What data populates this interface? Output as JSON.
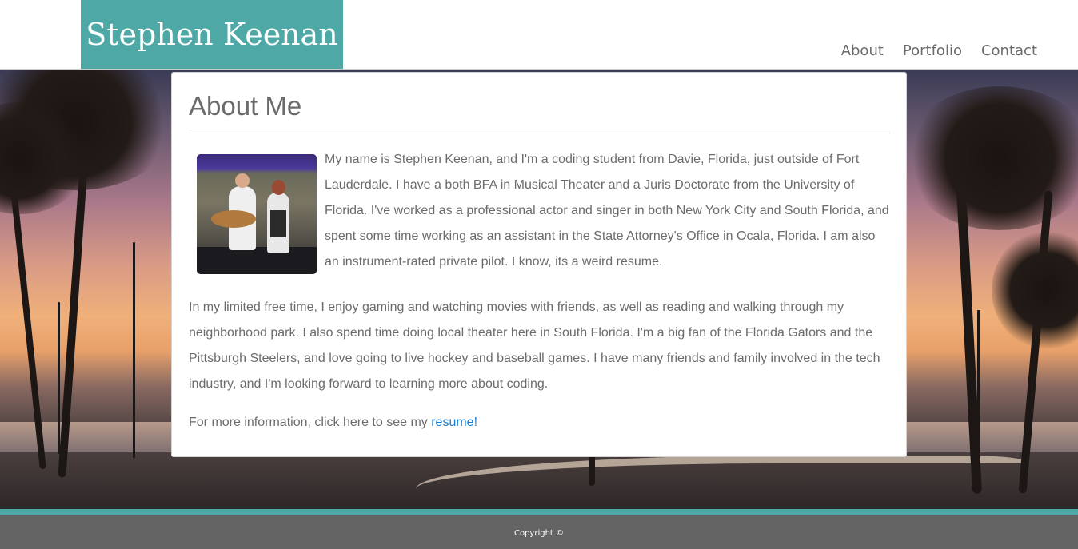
{
  "header": {
    "brand": "Stephen Keenan",
    "nav": [
      "About",
      "Portfolio",
      "Contact"
    ]
  },
  "about": {
    "title": "About Me",
    "paragraph1": "My name is Stephen Keenan, and I'm a coding student from Davie, Florida, just outside of Fort Lauderdale. I have a both BFA in Musical Theater and a Juris Doctorate from the University of Florida. I've worked as a professional actor and singer in both New York City and South Florida, and spent some time working as an assistant in the State Attorney's Office in Ocala, Florida. I am also an instrument-rated private pilot. I know, its a weird resume.",
    "paragraph2": "In my limited free time, I enjoy gaming and watching movies with friends, as well as reading and walking through my neighborhood park. I also spend time doing local theater here in South Florida. I'm a big fan of the Florida Gators and the Pittsburgh Steelers, and love going to live hockey and baseball games. I have many friends and family involved in the tech industry, and I'm looking forward to learning more about coding.",
    "more_info_prefix": "For more information, click here to see my ",
    "resume_link": "resume!"
  },
  "footer": {
    "copyright": "Copyright ©"
  },
  "colors": {
    "accent": "#4ea8a5",
    "footer_bg": "#646464",
    "link": "#1a7ed0",
    "text": "#6b6b6b"
  }
}
